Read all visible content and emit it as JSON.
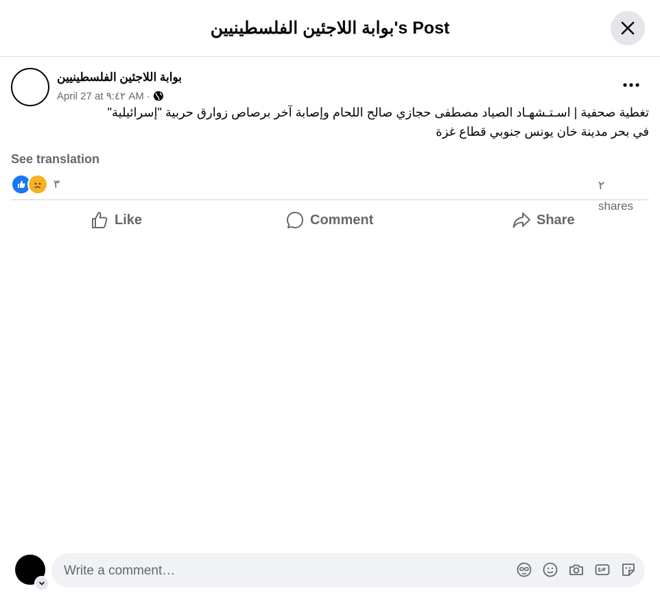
{
  "header": {
    "title": "بوابة اللاجئين الفلسطينيين's Post"
  },
  "post": {
    "page_name": "بوابة اللاجئين الفلسطينيين",
    "timestamp": "April 27 at ٩:٤٢ AM",
    "separator": "·",
    "text_line1": "تغطية صحفية | اسـتـشهـاد الصياد مصطفى حجازي صالح اللحام وإصابة آخر برصاص زوارق حربية \"إسرائيلية\"",
    "text_line2": "في بحر مدينة خان يونس جنوبي قطاع غزة",
    "see_translation": "See translation",
    "reaction_count": "٣",
    "share_count": "٢",
    "shares_label": "shares"
  },
  "actions": {
    "like": "Like",
    "comment": "Comment",
    "share": "Share"
  },
  "composer": {
    "placeholder": "Write a comment…"
  },
  "colors": {
    "accent": "#1877f2",
    "muted": "#65676b",
    "sad": "#f7b125"
  }
}
